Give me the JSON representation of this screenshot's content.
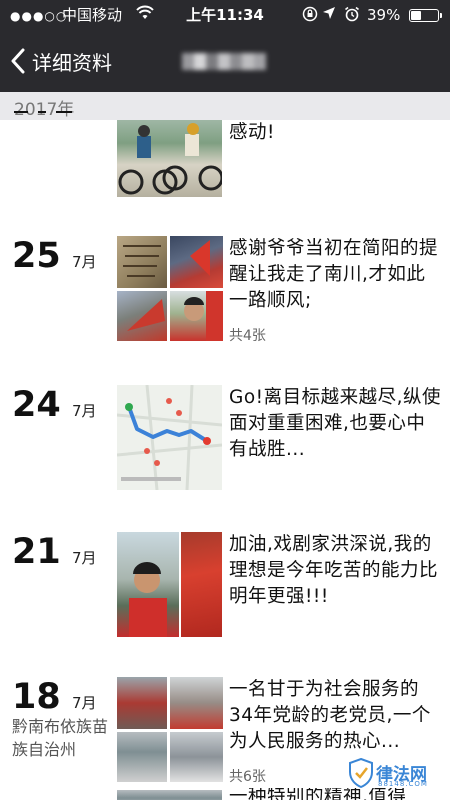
{
  "status_bar": {
    "signal": "●●●○○",
    "carrier": "中国移动",
    "time": "上午11:34",
    "battery_percent": "39%",
    "battery_level": 0.39
  },
  "nav": {
    "back_label": "详细资料"
  },
  "year_header": "2017年",
  "posts": [
    {
      "text": "感动!"
    },
    {
      "day": "25",
      "month": "7月",
      "text": "感谢爷爷当初在简阳的提醒让我走了南川,才如此一路顺风;",
      "count": "共4张"
    },
    {
      "day": "24",
      "month": "7月",
      "text": "Go!离目标越来越尽,纵使面对重重困难,也要心中有战胜..."
    },
    {
      "day": "21",
      "month": "7月",
      "text": "加油,戏剧家洪深说,我的理想是今年吃苦的能力比明年更强!!!"
    },
    {
      "day": "18",
      "month": "7月",
      "location": "黔南布依族苗族自治州",
      "text": "一名甘于为社会服务的34年党龄的老党员,一个为人民服务的热心...",
      "count": "共6张"
    },
    {
      "text": "一种特别的精神,值得"
    }
  ],
  "watermark": {
    "text": "律法网",
    "sub": "88148.COM"
  },
  "colors": {
    "topbar": "#2a2a2e",
    "year_bar": "#e9e9ec",
    "watermark": "#3a86d6"
  }
}
